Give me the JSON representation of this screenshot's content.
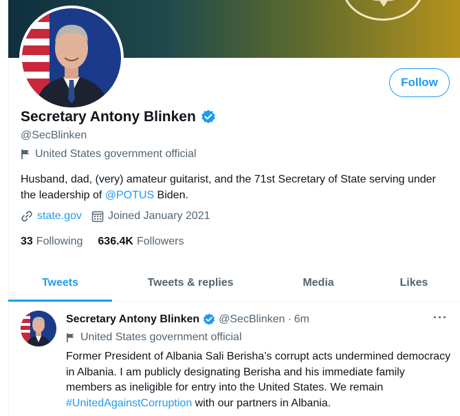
{
  "colors": {
    "accent": "#1d9bf0",
    "muted": "#536471",
    "text": "#0f1419",
    "border": "#eff3f4"
  },
  "profile": {
    "name": "Secretary Antony Blinken",
    "handle": "@SecBlinken",
    "affiliation": "United States government official",
    "bio_part1": "Husband, dad, (very) amateur guitarist, and the 71st Secretary of State serving under the leadership of ",
    "bio_mention": "@POTUS",
    "bio_part2": " Biden.",
    "website": "state.gov",
    "joined": "Joined January 2021",
    "following_count": "33",
    "following_label": "Following",
    "followers_count": "636.4K",
    "followers_label": "Followers",
    "follow_button": "Follow"
  },
  "tabs": [
    {
      "label": "Tweets",
      "active": true
    },
    {
      "label": "Tweets & replies",
      "active": false
    },
    {
      "label": "Media",
      "active": false
    },
    {
      "label": "Likes",
      "active": false
    }
  ],
  "tweet": {
    "name": "Secretary Antony Blinken",
    "handle": "@SecBlinken",
    "dot": "·",
    "time": "6m",
    "more": "···",
    "affiliation": "United States government official",
    "text_part1": "Former President of Albania Sali Berisha’s corrupt acts undermined democracy in Albania. I am publicly designating Berisha and his immediate family members as ineligible for entry into the United States. We remain ",
    "hashtag": "#UnitedAgainstCorruption",
    "text_part2": " with our partners in Albania."
  },
  "icons": {
    "verified": "verified-badge-icon",
    "affiliation": "flag-icon",
    "website": "link-icon",
    "joined": "calendar-icon",
    "more": "more-dots-icon"
  }
}
